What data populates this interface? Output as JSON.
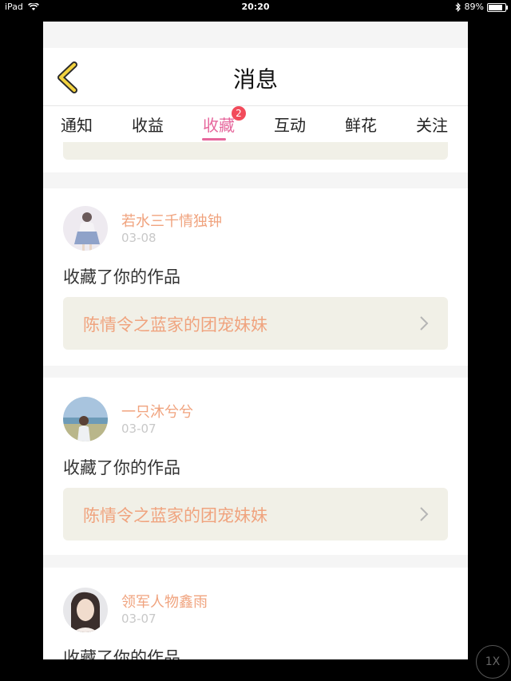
{
  "status_bar": {
    "device": "iPad",
    "time": "20:20",
    "battery": "89%",
    "battery_level": 0.89
  },
  "nav": {
    "title": "消息",
    "back_icon": "chevron-left-icon"
  },
  "tabs": [
    {
      "label": "通知"
    },
    {
      "label": "收益"
    },
    {
      "label": "收藏",
      "active": true,
      "badge": "2"
    },
    {
      "label": "互动"
    },
    {
      "label": "鲜花"
    },
    {
      "label": "关注"
    }
  ],
  "messages": [
    {
      "username": "若水三千情独钟",
      "date": "03-08",
      "action": "收藏了你的作品",
      "work_title": "陈情令之蓝家的团宠妹妹"
    },
    {
      "username": "一只沐兮兮",
      "date": "03-07",
      "action": "收藏了你的作品",
      "work_title": "陈情令之蓝家的团宠妹妹"
    },
    {
      "username": "领军人物鑫雨",
      "date": "03-07",
      "action": "收藏了你的作品",
      "work_title": ""
    }
  ],
  "zoom_button": "1X",
  "colors": {
    "accent": "#e6679c",
    "username": "#f0a37e",
    "badge": "#f24b5b",
    "work_box": "#f1f0e7"
  }
}
